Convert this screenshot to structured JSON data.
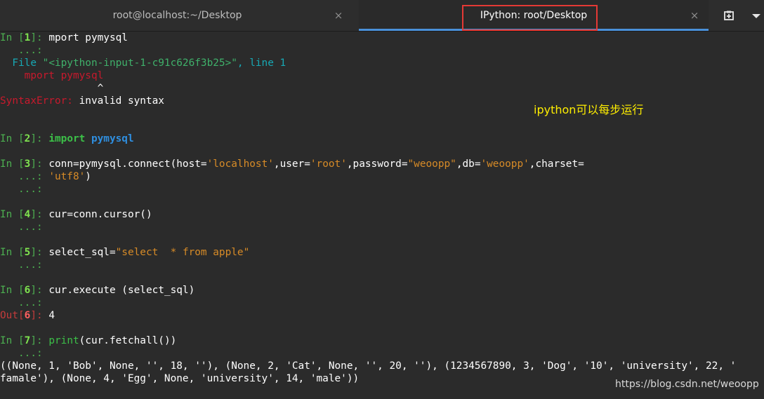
{
  "tabs": [
    {
      "label": "root@localhost:~/Desktop",
      "close": "×"
    },
    {
      "label": "IPython: root/Desktop",
      "close": "×"
    }
  ],
  "toolbar": {
    "new_tab_icon": "new-tab-icon",
    "menu_icon": "chevron-down-icon"
  },
  "prompts": {
    "in_open": "In [",
    "in_close": "]: ",
    "out_open": "Out[",
    "out_close": "]: ",
    "continuation": "   ...: "
  },
  "cells": [
    {
      "n": "1",
      "code": "mport pymysql"
    },
    {
      "n": "2",
      "kw": "import",
      "sp": " ",
      "mod": "pymysql"
    },
    {
      "n": "3",
      "a": "conn=pymysql.connect(host=",
      "s1": "'localhost'",
      "b": ",user=",
      "s2": "'root'",
      "c": ",password=",
      "s3": "\"weoopp\"",
      "d": ",db=",
      "s4": "'weoopp'",
      "e": ",charset=",
      "s5": "'utf8'",
      "f": ")"
    },
    {
      "n": "4",
      "code": "cur=conn.cursor()"
    },
    {
      "n": "5",
      "a": "select_sql=",
      "s": "\"select  * from apple\""
    },
    {
      "n": "6",
      "code": "cur.execute (select_sql)"
    },
    {
      "n": "7",
      "fn": "print",
      "rest": "(cur.fetchall())"
    }
  ],
  "traceback": {
    "file_kw": "  File ",
    "file_path": "\"<ipython-input-1-c91c626f3b25>\"",
    "file_line": ", line 1",
    "code_line": "    mport pymysql",
    "caret": "                ^",
    "error_name": "SyntaxError:",
    "error_msg": " invalid syntax"
  },
  "out6": {
    "n": "6",
    "value": "4"
  },
  "result_lines": [
    "((None, 1, 'Bob', None, '', 18, ''), (None, 2, 'Cat', None, '', 20, ''), (1234567890, 3, 'Dog', '10', 'university', 22, '",
    "famale'), (None, 4, 'Egg', None, 'university', 14, 'male'))"
  ],
  "annotation": "ipython可以每步运行",
  "watermark": "https://blog.csdn.net/weoopp",
  "colors": {
    "accent": "#4a90d9",
    "highlight": "#e53935",
    "annotation": "#ffee00"
  }
}
